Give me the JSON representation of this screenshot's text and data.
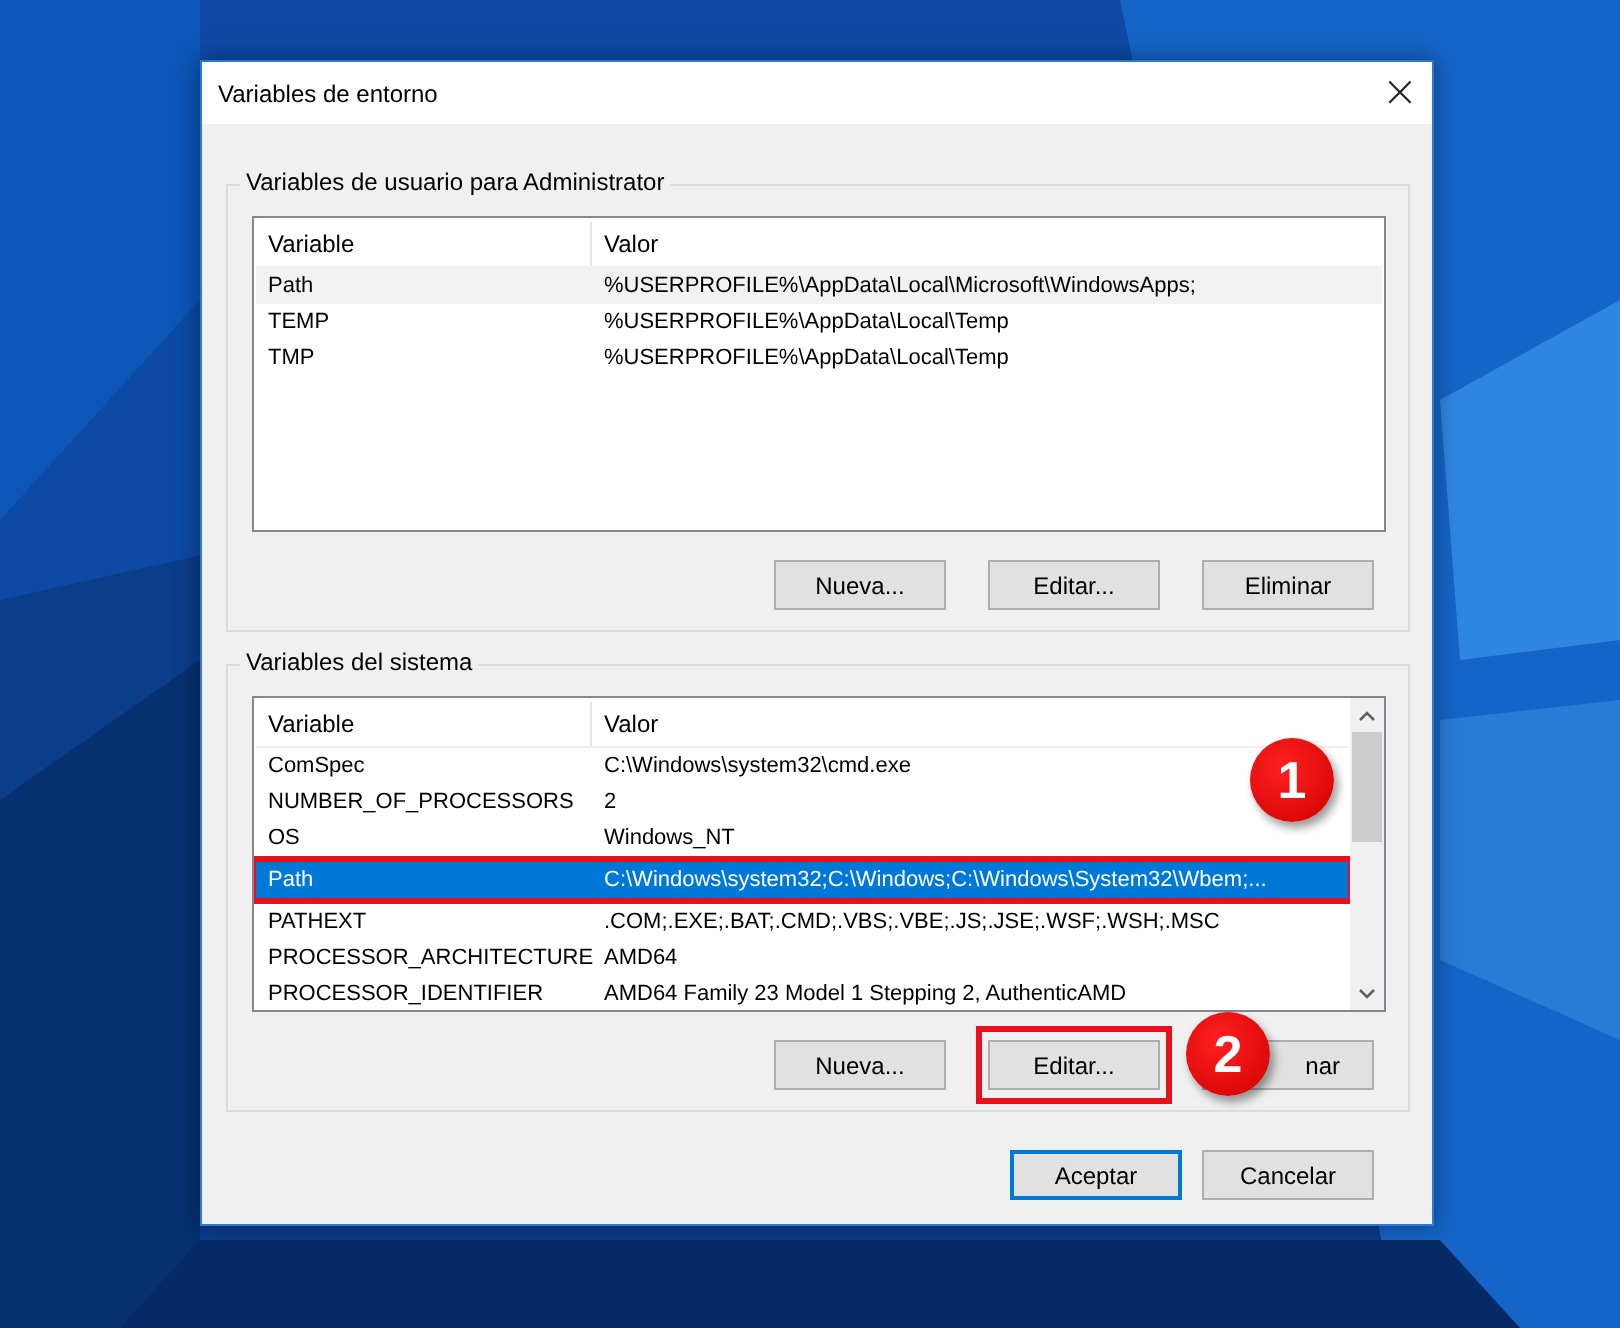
{
  "window": {
    "title": "Variables de entorno",
    "close": "×"
  },
  "user_group": {
    "title": "Variables de usuario para Administrator",
    "columns": [
      "Variable",
      "Valor"
    ],
    "rows": [
      {
        "name": "Path",
        "value": "%USERPROFILE%\\AppData\\Local\\Microsoft\\WindowsApps;",
        "selected": true,
        "highlighted": false
      },
      {
        "name": "TEMP",
        "value": "%USERPROFILE%\\AppData\\Local\\Temp",
        "selected": false,
        "highlighted": false
      },
      {
        "name": "TMP",
        "value": "%USERPROFILE%\\AppData\\Local\\Temp",
        "selected": false,
        "highlighted": false
      }
    ],
    "focused": false,
    "buttons": [
      {
        "label": "Nueva...",
        "highlighted": false
      },
      {
        "label": "Editar...",
        "highlighted": false
      },
      {
        "label": "Eliminar",
        "highlighted": false
      }
    ]
  },
  "system_group": {
    "title": "Variables del sistema",
    "columns": [
      "Variable",
      "Valor"
    ],
    "badge": "1",
    "rows": [
      {
        "name": "ComSpec",
        "value": "C:\\Windows\\system32\\cmd.exe",
        "selected": false,
        "highlighted": false
      },
      {
        "name": "NUMBER_OF_PROCESSORS",
        "value": "2",
        "selected": false,
        "highlighted": false
      },
      {
        "name": "OS",
        "value": "Windows_NT",
        "selected": false,
        "highlighted": false
      },
      {
        "name": "Path",
        "value": "C:\\Windows\\system32;C:\\Windows;C:\\Windows\\System32\\Wbem;...",
        "selected": true,
        "highlighted": true
      },
      {
        "name": "PATHEXT",
        "value": ".COM;.EXE;.BAT;.CMD;.VBS;.VBE;.JS;.JSE;.WSF;.WSH;.MSC",
        "selected": false,
        "highlighted": false
      },
      {
        "name": "PROCESSOR_ARCHITECTURE",
        "value": "AMD64",
        "selected": false,
        "highlighted": false
      },
      {
        "name": "PROCESSOR_IDENTIFIER",
        "value": "AMD64 Family 23 Model 1 Stepping 2, AuthenticAMD",
        "selected": false,
        "highlighted": false
      }
    ],
    "focused": true,
    "buttons": [
      {
        "label": "Nueva...",
        "highlighted": false
      },
      {
        "label": "Editar...",
        "highlighted": true,
        "badge": "2"
      },
      {
        "label": "nar",
        "highlighted": false
      }
    ]
  },
  "footer_buttons": [
    {
      "label": "Aceptar",
      "default": true
    },
    {
      "label": "Cancelar",
      "default": false
    }
  ]
}
